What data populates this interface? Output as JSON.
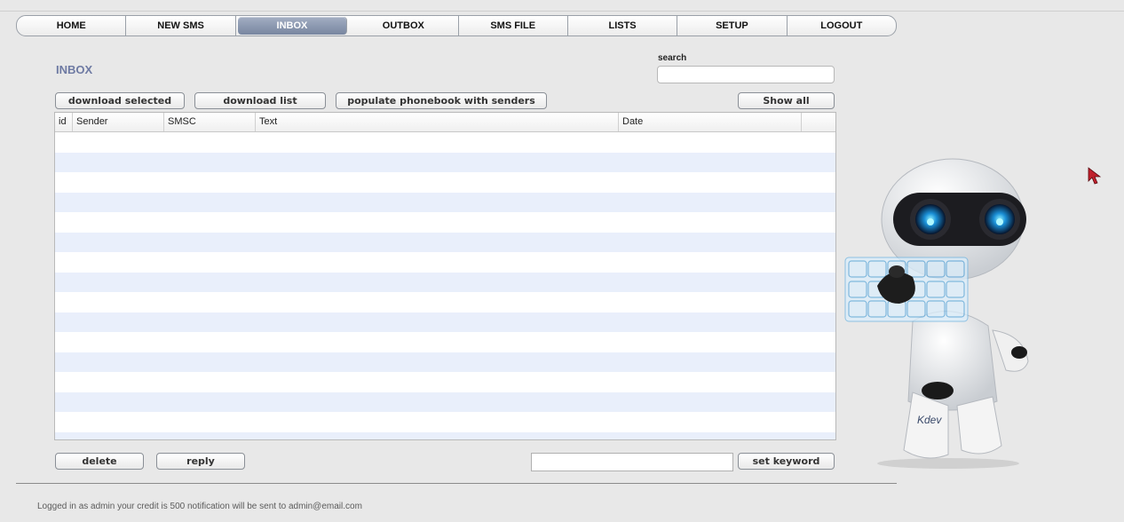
{
  "nav": {
    "items": [
      "HOME",
      "NEW SMS",
      "INBOX",
      "OUTBOX",
      "SMS FILE",
      "LISTS",
      "SETUP",
      "LOGOUT"
    ],
    "active": "INBOX"
  },
  "page": {
    "title": "INBOX"
  },
  "search": {
    "label": "search",
    "value": ""
  },
  "toolbar": {
    "download_selected": "download selected",
    "download_list": "download list",
    "populate": "populate phonebook with senders",
    "show_all": "Show all"
  },
  "table": {
    "columns": [
      "id",
      "Sender",
      "SMSC",
      "Text",
      "Date"
    ],
    "rows": []
  },
  "actions": {
    "delete": "delete",
    "reply": "reply",
    "keyword_value": "",
    "set_keyword": "set keyword"
  },
  "footer": {
    "status": "Logged in as admin your credit is 500 notification will be sent to admin@email.com"
  },
  "branding": {
    "mascot_text": "Kdev"
  },
  "colors": {
    "accent": "#6e7aa3",
    "active_tab": "#8a97b0",
    "row_alt": "#e9effb"
  }
}
